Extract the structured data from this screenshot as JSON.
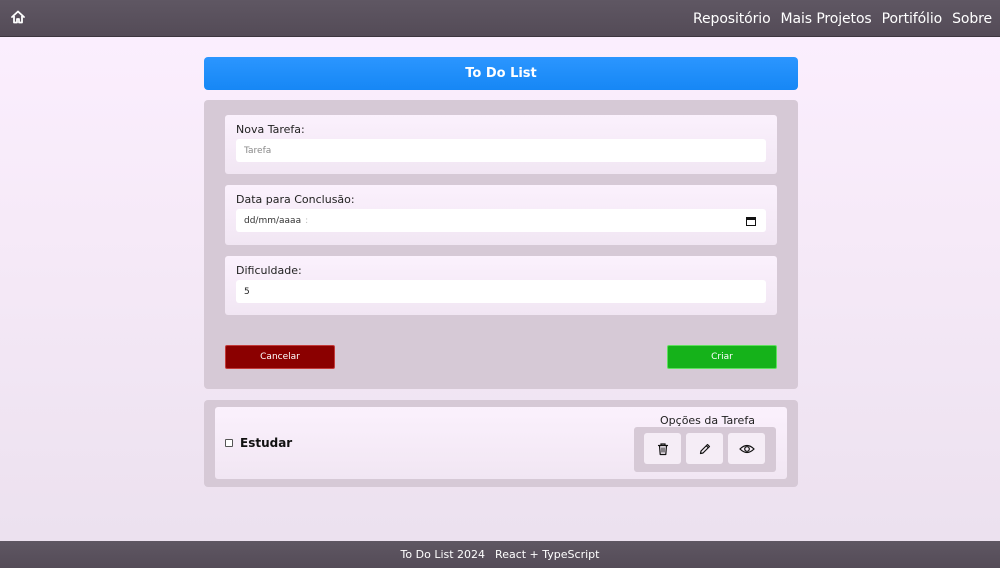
{
  "nav": {
    "home_icon": "home-icon",
    "links": [
      "Repositório",
      "Mais Projetos",
      "Portifólio",
      "Sobre"
    ]
  },
  "app": {
    "title": "To Do List"
  },
  "form": {
    "task": {
      "label": "Nova Tarefa:",
      "placeholder": "Tarefa",
      "value": ""
    },
    "due_date": {
      "label": "Data para Conclusão:",
      "format": "dd/mm/aaaa",
      "time": ":",
      "icon": "calendar-icon"
    },
    "difficulty": {
      "label": "Dificuldade:",
      "value": "5"
    },
    "cancel_label": "Cancelar",
    "create_label": "Criar",
    "colors": {
      "cancel": "#8b0000",
      "create": "#15b21a",
      "title_bar": "#1687f5"
    }
  },
  "tasks": [
    {
      "name": "Estudar",
      "checked": false,
      "options_title": "Opções da Tarefa",
      "options": [
        "trash-icon",
        "pencil-icon",
        "eye-icon"
      ]
    }
  ],
  "footer": {
    "app": "To Do List 2024",
    "stack": "React + TypeScript"
  }
}
